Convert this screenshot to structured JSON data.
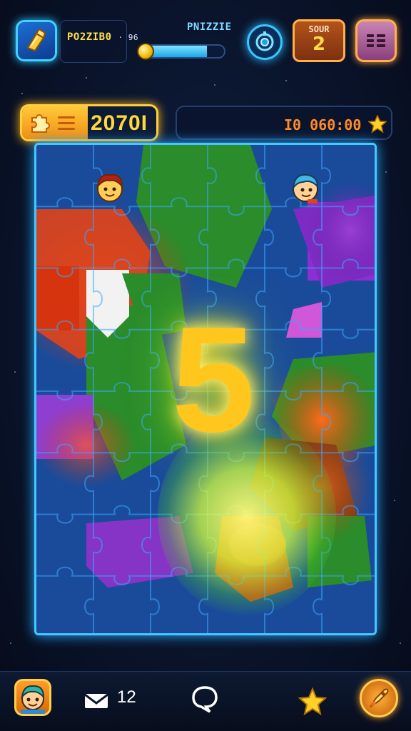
{
  "header": {
    "title_main": "PO2ZIB0",
    "title_sub": "· 96",
    "puzzle_label": "PNIZZIE",
    "progress": 0.78,
    "score_label": "SOUR",
    "score_value": "2"
  },
  "level": {
    "value": "2070I"
  },
  "timer": {
    "value": "I0 060:00"
  },
  "board": {
    "big_number": "5",
    "accent": "#43c9ff"
  },
  "bottom": {
    "count": "12"
  },
  "icons": {
    "tool": "glue-bottle-icon",
    "target": "target-icon",
    "menu": "menu-icon",
    "mail": "mail-icon",
    "chat": "chat-bubble-icon",
    "star": "star-icon",
    "boost": "rocket-icon"
  },
  "colors": {
    "board_border": "#43c9ff",
    "score_border": "#ffb04a",
    "level_glow": "#ffcf3a",
    "number": "#ffc71e"
  }
}
